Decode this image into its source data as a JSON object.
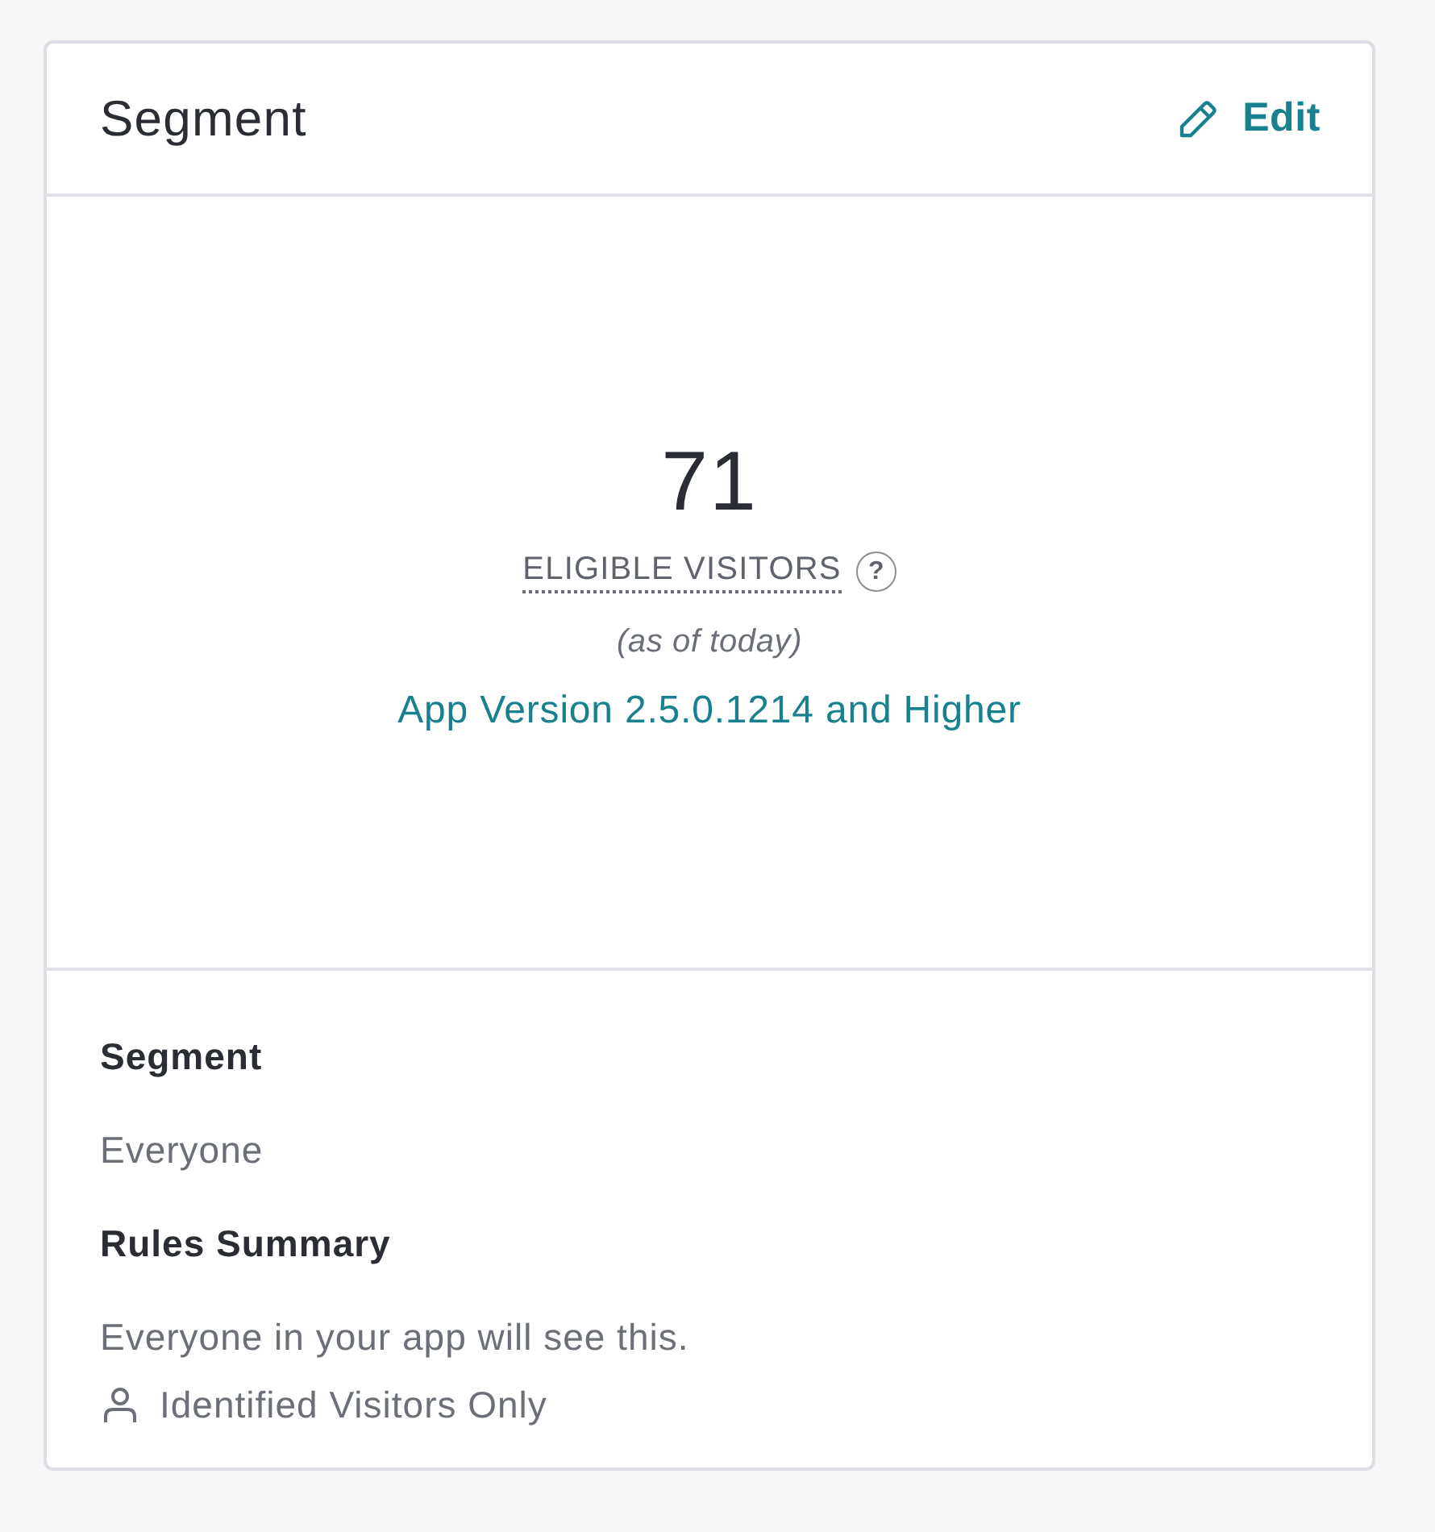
{
  "card": {
    "title": "Segment",
    "edit_link": "Edit"
  },
  "audience": {
    "count": "71",
    "label": "ELIGIBLE VISITORS",
    "help": "?",
    "note": "(as of today)",
    "segment_link": "App Version 2.5.0.1214 and Higher"
  },
  "details": [
    {
      "kind": "heading",
      "text": "Segment"
    },
    {
      "kind": "value",
      "text": "Everyone"
    },
    {
      "kind": "heading",
      "text": "Rules Summary"
    },
    {
      "kind": "value",
      "text": "Everyone in your app will see this."
    },
    {
      "kind": "rule",
      "text": "Identified Visitors Only"
    }
  ]
}
